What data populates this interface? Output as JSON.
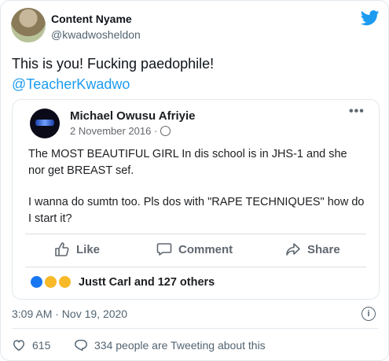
{
  "tweet": {
    "author_name": "Content Nyame",
    "author_handle": "@kwadwosheldon",
    "text_line1": "This is you! Fucking paedophile!",
    "mention": "@TeacherKwadwo",
    "timestamp": "3:09 AM · Nov 19, 2020",
    "like_count": "615",
    "reply_text": "334 people are Tweeting about this"
  },
  "facebook_post": {
    "name": "Michael Owusu Afriyie",
    "date": "2 November 2016 ·",
    "more": "•••",
    "body_p1": "The MOST BEAUTIFUL GIRL In dis school is in JHS-1 and she nor get BREAST sef.",
    "body_p2": "I wanna do sumtn too. Pls dos with \"RAPE TECHNIQUES\" how do I start it?",
    "actions": {
      "like": "Like",
      "comment": "Comment",
      "share": "Share"
    },
    "reactions_label": "Justt Carl and 127 others"
  },
  "colors": {
    "twitter_blue": "#1d9bf0",
    "facebook_blue": "#1877f2",
    "reaction_yellow": "#f7b928",
    "muted_text": "#536471"
  },
  "icons": [
    "twitter-bird-icon",
    "globe-icon",
    "more-icon",
    "like-thumb-icon",
    "comment-icon",
    "share-icon",
    "info-icon",
    "heart-icon",
    "reply-bubble-icon"
  ]
}
